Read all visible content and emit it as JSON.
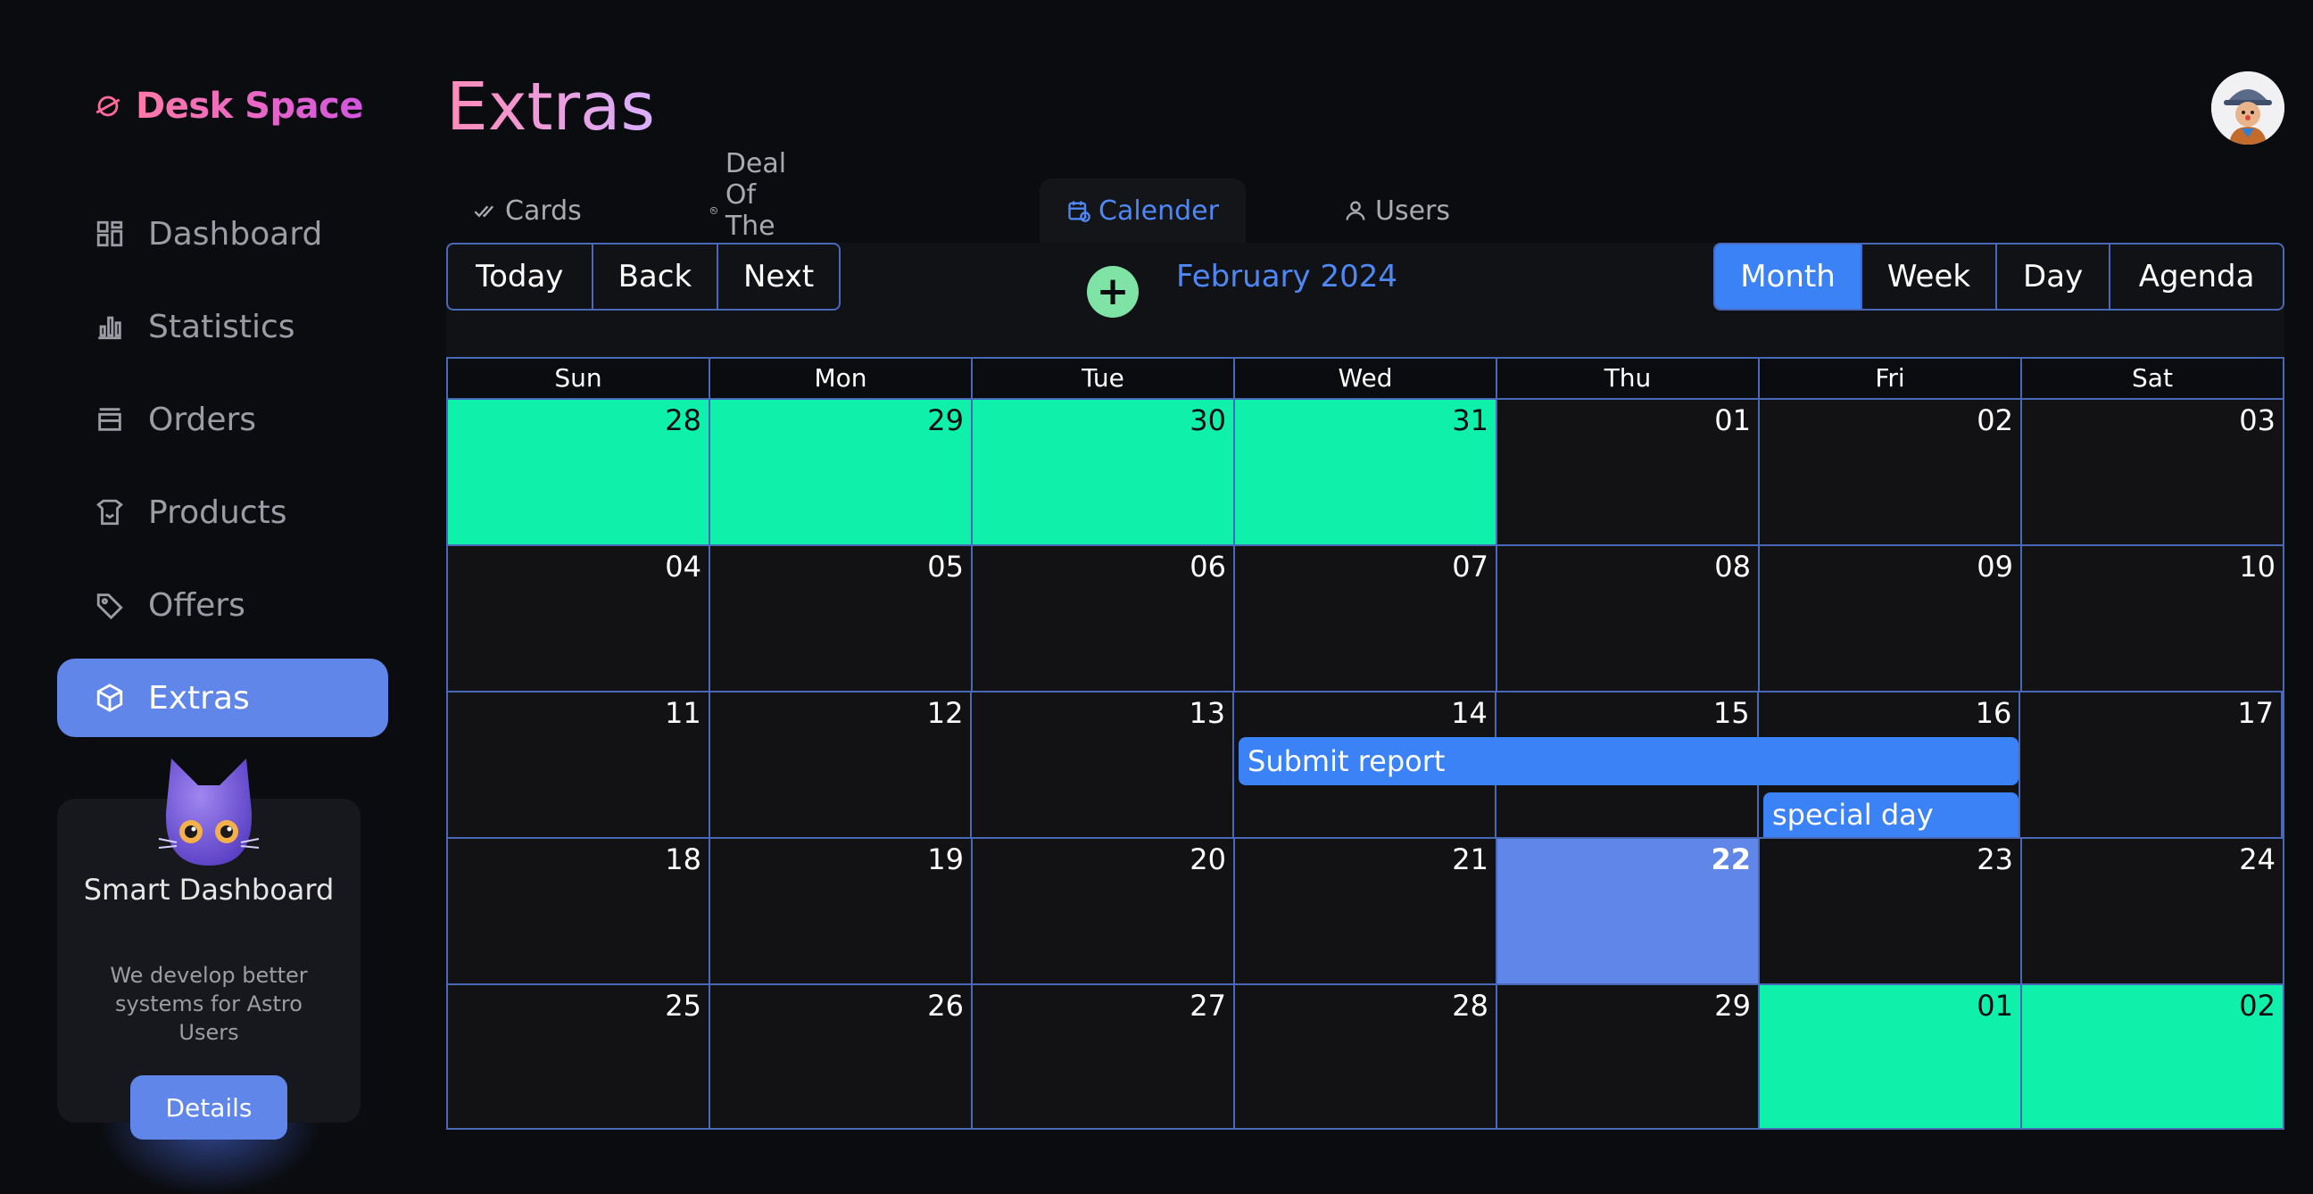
{
  "app": {
    "name": "Desk Space"
  },
  "sidebar": {
    "items": [
      {
        "label": "Dashboard",
        "icon": "dashboard-icon"
      },
      {
        "label": "Statistics",
        "icon": "statistics-icon"
      },
      {
        "label": "Orders",
        "icon": "orders-icon"
      },
      {
        "label": "Products",
        "icon": "products-icon"
      },
      {
        "label": "Offers",
        "icon": "offers-icon"
      },
      {
        "label": "Extras",
        "icon": "extras-icon",
        "active": true
      }
    ],
    "promo": {
      "title": "Smart Dashboard",
      "description": "We develop better systems for Astro Users",
      "button": "Details"
    }
  },
  "header": {
    "title": "Extras"
  },
  "tabs": [
    {
      "label": "Cards",
      "icon": "check-double-icon"
    },
    {
      "label": "Deal Of The Day",
      "icon": "deal-icon"
    },
    {
      "label": "Calender",
      "icon": "calendar-icon",
      "active": true
    },
    {
      "label": "Users",
      "icon": "user-icon"
    }
  ],
  "calendar": {
    "nav_buttons": [
      "Today",
      "Back",
      "Next"
    ],
    "add_label": "+",
    "month_label": "February 2024",
    "views": [
      "Month",
      "Week",
      "Day",
      "Agenda"
    ],
    "active_view": "Month",
    "weekdays": [
      "Sun",
      "Mon",
      "Tue",
      "Wed",
      "Thu",
      "Fri",
      "Sat"
    ],
    "weeks": [
      [
        "28",
        "29",
        "30",
        "31",
        "01",
        "02",
        "03"
      ],
      [
        "04",
        "05",
        "06",
        "07",
        "08",
        "09",
        "10"
      ],
      [
        "11",
        "12",
        "13",
        "14",
        "15",
        "16",
        "17"
      ],
      [
        "18",
        "19",
        "20",
        "21",
        "22",
        "23",
        "24"
      ],
      [
        "25",
        "26",
        "27",
        "28",
        "29",
        "01",
        "02"
      ]
    ],
    "today": "22",
    "events": [
      {
        "title": "Submit report"
      },
      {
        "title": "special day"
      }
    ]
  },
  "colors": {
    "accent": "#3b82f6",
    "active_nav": "#5f86e8",
    "off_month": "#0ff0aa",
    "today": "#5f86e8",
    "grid_border": "#4a68b8"
  }
}
